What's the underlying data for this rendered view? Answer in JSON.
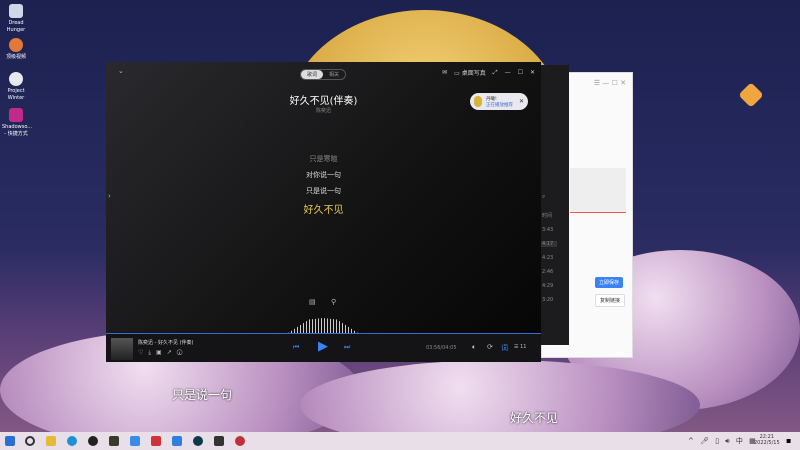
{
  "desktop": {
    "icons": [
      {
        "label": "Dread Hunger"
      },
      {
        "label": "顶级视频"
      },
      {
        "label": "Project Winter"
      },
      {
        "label": "Shadowso... - 快捷方式"
      }
    ]
  },
  "player": {
    "tabs": [
      "歌词",
      "相关"
    ],
    "toolbar": {
      "desktop_lyrics": "桌面写真"
    },
    "song_title": "好久不见(伴奏)",
    "artist": "陈奕迅",
    "bubble": {
      "line1": "丹曦!",
      "line2": "正在播放推荐"
    },
    "lyrics": [
      "只是寒暄",
      "对你说一句",
      "只是说一句",
      "好久不见"
    ],
    "now_playing": "陈奕迅 - 好久不见 (伴奏)",
    "time": "03:56/04:05",
    "playlist_count": "11",
    "progress": 0.965
  },
  "side_list": {
    "header": "时间",
    "times": [
      "3:43",
      "4:17",
      "4:23",
      "2:46",
      "4:29",
      "3:20"
    ]
  },
  "white_window": {
    "save_button": "立即保存",
    "copy_link_button": "复制链接"
  },
  "subtitles": [
    "只是说一句",
    "好久不见"
  ],
  "taskbar": {
    "time": "22:21",
    "date": "2022/5/15"
  }
}
